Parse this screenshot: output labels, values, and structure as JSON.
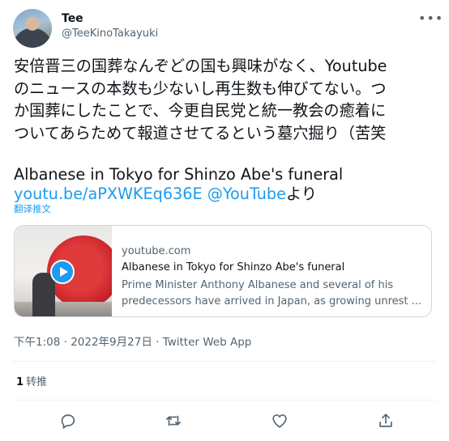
{
  "author": {
    "display_name": "Tee",
    "handle": "@TeeKinoTakayuki"
  },
  "tweet": {
    "lines": [
      "安倍晋三の国葬なんぞどの国も興味がなく、Youtube",
      "のニュースの本数も少ないし再生数も伸びてない。つ",
      "か国葬にしたことで、今更自民党と統一教会の癒着に",
      "ついてあらためて報道させてるという墓穴掘り（苦笑"
    ],
    "share_title": "Albanese in Tokyo for Shinzo Abe's funeral",
    "link_url": "youtu.be/aPXWKEq636E",
    "link_mention": "@YouTube",
    "link_suffix": "より",
    "translate_label": "翻译推文"
  },
  "card": {
    "domain": "youtube.com",
    "title": "Albanese in Tokyo for Shinzo Abe's funeral",
    "description_line1": "Prime Minister Anthony Albanese and several of his",
    "description_line2": "predecessors have arrived in Japan, as growing unrest ..."
  },
  "meta": {
    "time": "下午1:08",
    "separator1": " · ",
    "date": "2022年9月27日",
    "separator2": " · ",
    "source": "Twitter Web App"
  },
  "stats": {
    "retweets_count": "1",
    "retweets_label": "转推"
  },
  "icons": {
    "more": "more-horizontal-icon",
    "reply": "reply-icon",
    "retweet": "retweet-icon",
    "like": "like-icon",
    "share": "share-icon"
  },
  "colors": {
    "accent": "#1d9bf0",
    "secondary_text": "#536471",
    "border": "#cfd9de"
  }
}
